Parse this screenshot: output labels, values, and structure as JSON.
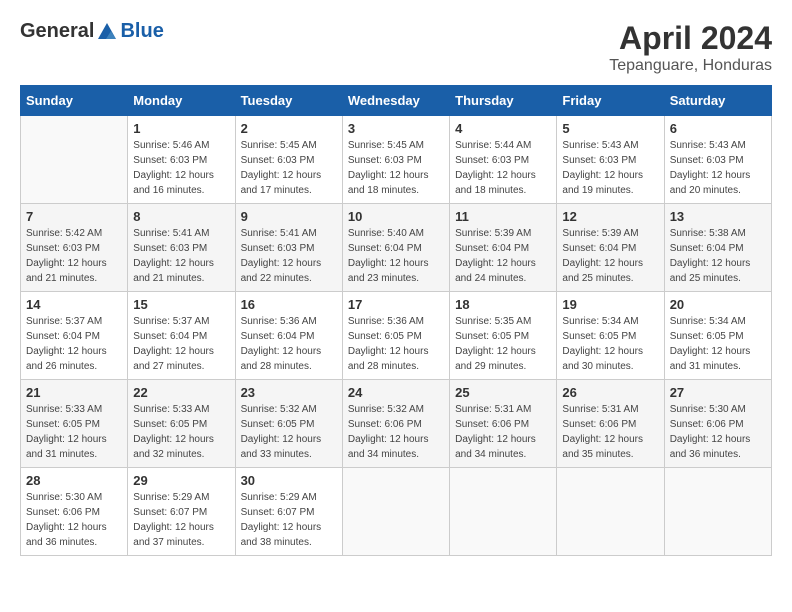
{
  "header": {
    "logo_general": "General",
    "logo_blue": "Blue",
    "month_title": "April 2024",
    "subtitle": "Tepanguare, Honduras"
  },
  "calendar": {
    "days_of_week": [
      "Sunday",
      "Monday",
      "Tuesday",
      "Wednesday",
      "Thursday",
      "Friday",
      "Saturday"
    ],
    "weeks": [
      [
        {
          "day": "",
          "sunrise": "",
          "sunset": "",
          "daylight": ""
        },
        {
          "day": "1",
          "sunrise": "Sunrise: 5:46 AM",
          "sunset": "Sunset: 6:03 PM",
          "daylight": "Daylight: 12 hours and 16 minutes."
        },
        {
          "day": "2",
          "sunrise": "Sunrise: 5:45 AM",
          "sunset": "Sunset: 6:03 PM",
          "daylight": "Daylight: 12 hours and 17 minutes."
        },
        {
          "day": "3",
          "sunrise": "Sunrise: 5:45 AM",
          "sunset": "Sunset: 6:03 PM",
          "daylight": "Daylight: 12 hours and 18 minutes."
        },
        {
          "day": "4",
          "sunrise": "Sunrise: 5:44 AM",
          "sunset": "Sunset: 6:03 PM",
          "daylight": "Daylight: 12 hours and 18 minutes."
        },
        {
          "day": "5",
          "sunrise": "Sunrise: 5:43 AM",
          "sunset": "Sunset: 6:03 PM",
          "daylight": "Daylight: 12 hours and 19 minutes."
        },
        {
          "day": "6",
          "sunrise": "Sunrise: 5:43 AM",
          "sunset": "Sunset: 6:03 PM",
          "daylight": "Daylight: 12 hours and 20 minutes."
        }
      ],
      [
        {
          "day": "7",
          "sunrise": "Sunrise: 5:42 AM",
          "sunset": "Sunset: 6:03 PM",
          "daylight": "Daylight: 12 hours and 21 minutes."
        },
        {
          "day": "8",
          "sunrise": "Sunrise: 5:41 AM",
          "sunset": "Sunset: 6:03 PM",
          "daylight": "Daylight: 12 hours and 21 minutes."
        },
        {
          "day": "9",
          "sunrise": "Sunrise: 5:41 AM",
          "sunset": "Sunset: 6:03 PM",
          "daylight": "Daylight: 12 hours and 22 minutes."
        },
        {
          "day": "10",
          "sunrise": "Sunrise: 5:40 AM",
          "sunset": "Sunset: 6:04 PM",
          "daylight": "Daylight: 12 hours and 23 minutes."
        },
        {
          "day": "11",
          "sunrise": "Sunrise: 5:39 AM",
          "sunset": "Sunset: 6:04 PM",
          "daylight": "Daylight: 12 hours and 24 minutes."
        },
        {
          "day": "12",
          "sunrise": "Sunrise: 5:39 AM",
          "sunset": "Sunset: 6:04 PM",
          "daylight": "Daylight: 12 hours and 25 minutes."
        },
        {
          "day": "13",
          "sunrise": "Sunrise: 5:38 AM",
          "sunset": "Sunset: 6:04 PM",
          "daylight": "Daylight: 12 hours and 25 minutes."
        }
      ],
      [
        {
          "day": "14",
          "sunrise": "Sunrise: 5:37 AM",
          "sunset": "Sunset: 6:04 PM",
          "daylight": "Daylight: 12 hours and 26 minutes."
        },
        {
          "day": "15",
          "sunrise": "Sunrise: 5:37 AM",
          "sunset": "Sunset: 6:04 PM",
          "daylight": "Daylight: 12 hours and 27 minutes."
        },
        {
          "day": "16",
          "sunrise": "Sunrise: 5:36 AM",
          "sunset": "Sunset: 6:04 PM",
          "daylight": "Daylight: 12 hours and 28 minutes."
        },
        {
          "day": "17",
          "sunrise": "Sunrise: 5:36 AM",
          "sunset": "Sunset: 6:05 PM",
          "daylight": "Daylight: 12 hours and 28 minutes."
        },
        {
          "day": "18",
          "sunrise": "Sunrise: 5:35 AM",
          "sunset": "Sunset: 6:05 PM",
          "daylight": "Daylight: 12 hours and 29 minutes."
        },
        {
          "day": "19",
          "sunrise": "Sunrise: 5:34 AM",
          "sunset": "Sunset: 6:05 PM",
          "daylight": "Daylight: 12 hours and 30 minutes."
        },
        {
          "day": "20",
          "sunrise": "Sunrise: 5:34 AM",
          "sunset": "Sunset: 6:05 PM",
          "daylight": "Daylight: 12 hours and 31 minutes."
        }
      ],
      [
        {
          "day": "21",
          "sunrise": "Sunrise: 5:33 AM",
          "sunset": "Sunset: 6:05 PM",
          "daylight": "Daylight: 12 hours and 31 minutes."
        },
        {
          "day": "22",
          "sunrise": "Sunrise: 5:33 AM",
          "sunset": "Sunset: 6:05 PM",
          "daylight": "Daylight: 12 hours and 32 minutes."
        },
        {
          "day": "23",
          "sunrise": "Sunrise: 5:32 AM",
          "sunset": "Sunset: 6:05 PM",
          "daylight": "Daylight: 12 hours and 33 minutes."
        },
        {
          "day": "24",
          "sunrise": "Sunrise: 5:32 AM",
          "sunset": "Sunset: 6:06 PM",
          "daylight": "Daylight: 12 hours and 34 minutes."
        },
        {
          "day": "25",
          "sunrise": "Sunrise: 5:31 AM",
          "sunset": "Sunset: 6:06 PM",
          "daylight": "Daylight: 12 hours and 34 minutes."
        },
        {
          "day": "26",
          "sunrise": "Sunrise: 5:31 AM",
          "sunset": "Sunset: 6:06 PM",
          "daylight": "Daylight: 12 hours and 35 minutes."
        },
        {
          "day": "27",
          "sunrise": "Sunrise: 5:30 AM",
          "sunset": "Sunset: 6:06 PM",
          "daylight": "Daylight: 12 hours and 36 minutes."
        }
      ],
      [
        {
          "day": "28",
          "sunrise": "Sunrise: 5:30 AM",
          "sunset": "Sunset: 6:06 PM",
          "daylight": "Daylight: 12 hours and 36 minutes."
        },
        {
          "day": "29",
          "sunrise": "Sunrise: 5:29 AM",
          "sunset": "Sunset: 6:07 PM",
          "daylight": "Daylight: 12 hours and 37 minutes."
        },
        {
          "day": "30",
          "sunrise": "Sunrise: 5:29 AM",
          "sunset": "Sunset: 6:07 PM",
          "daylight": "Daylight: 12 hours and 38 minutes."
        },
        {
          "day": "",
          "sunrise": "",
          "sunset": "",
          "daylight": ""
        },
        {
          "day": "",
          "sunrise": "",
          "sunset": "",
          "daylight": ""
        },
        {
          "day": "",
          "sunrise": "",
          "sunset": "",
          "daylight": ""
        },
        {
          "day": "",
          "sunrise": "",
          "sunset": "",
          "daylight": ""
        }
      ]
    ]
  }
}
